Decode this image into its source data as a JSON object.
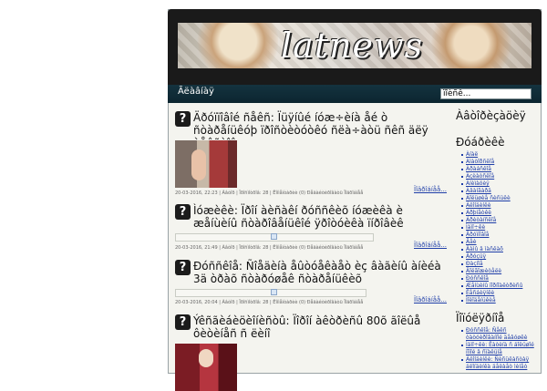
{
  "site": {
    "logo_text": "latnews"
  },
  "nav": {
    "home_label": "Ãëàâíàÿ"
  },
  "search": {
    "value": "ïîèñê..."
  },
  "posts": [
    {
      "title": "Äðóïïîâîé ñåêñ: Ïüÿíûé íóæ÷èíà åé ò ñòàðåíüêóþ ïðîñòèòóòêó ñëà÷àòü ñêñ äëÿ òåêñòîâ",
      "meta": "20-03-2016, 22:23 | Àâòîð | Ïðîñìîòðîâ: 28 | Êîììåíòàðèè (0) Ðåäàêòèðîâàòü Ïîäðîáíåå",
      "more": "Ïîäðîáíåå..."
    },
    {
      "title": "Ìóæèêè: Ïðîí àèñàêí ðóññêèõ íóæèêà è æåíùèíû ñòàðîâåíüêîé ÿðîòóèêà ïíðîâèê",
      "meta": "20-03-2016, 21:49 | Àâòîð | Ïðîñìîòðîâ: 28 | Êîììåíòàðèè (0) Ðåäàêòèðîâàòü Ïîäðîáíåå",
      "more": "Ïîäðîáíåå..."
    },
    {
      "title": "Ðóññêîå: Ñîåäèíà åûòóåêàåò èç âàãèíû àíèéà 3ä òðàõ ñòàðóøåê ñòàðåíüêèõ",
      "meta": "20-03-2016, 20:04 | Àâòîð | Ïðîñìîòðîâ: 28 | Êîììåíòàðèè (0) Ðåäàêòèðîâàòü Ïîäðîáíåå",
      "more": "Ïîäðîáíåå..."
    },
    {
      "title": "Ýêñãèáèöèîíèñòû: Ïîðîí àêòðèñû 80õ ãîëûå ôèòèíåñ ñ ëèíî"
    }
  ],
  "sidebar": {
    "head1": "Àâòîðèçàöèÿ",
    "head2": "Ðóáðèêè",
    "categories": [
      "Àíàë",
      "Àìàòîðñêîå",
      "Àðàáñêîå",
      "Àçèàòñêîå",
      "Àíèìàöèÿ",
      "Àâàíãàðä",
      "Áîëüøèå ñèñüêè",
      "Áëîíäèíêè",
      "Áðþíåòêè",
      "Áðèòàíñêîå",
      "Ìàìî÷êè",
      "Ãðóïïîâîå",
      "Ãåè",
      "Äàìû â ìàñêàõ",
      "Äðóçüÿ",
      "Ðàçíîå",
      "Äîëãîæèòåëè",
      "Ðóññêîå",
      "Æåíùèíû ïîðíîàêòðèñû",
      "Ëåñáèÿíêè",
      "Ìîëîäåíüêèå"
    ],
    "head3": "Ïîïóëÿðíîå",
    "popular": [
      "Ðóññêîå: Ñåêñ òàòóèðîâàííîé äåâóøêè",
      "Ìàìî÷êè: Ëàòèíà ñ áîëüøîé ïîïîé â ñïàëüíå",
      "Áëîíäèíêè: Ñèñüêàñòàÿ áëîíäèíêà äåëàåò ìèíåò"
    ]
  }
}
